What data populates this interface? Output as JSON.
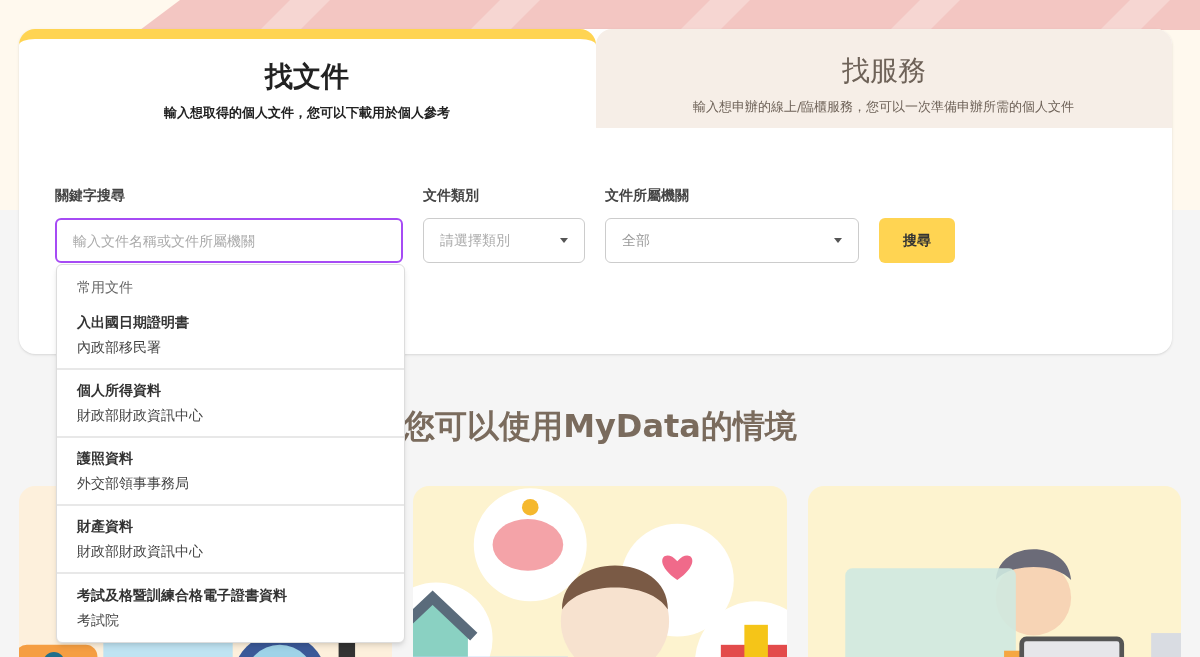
{
  "tabs": [
    {
      "title": "找文件",
      "subtitle": "輸入想取得的個人文件，您可以下載用於個人參考",
      "selected": true
    },
    {
      "title": "找服務",
      "subtitle": "輸入想申辦的線上/臨櫃服務，您可以一次準備申辦所需的個人文件",
      "selected": false
    }
  ],
  "search": {
    "keyword": {
      "label": "關鍵字搜尋",
      "placeholder": "輸入文件名稱或文件所屬機關",
      "focused": true
    },
    "category": {
      "label": "文件類別",
      "placeholder": "請選擇類別"
    },
    "agency": {
      "label": "文件所屬機關",
      "value": "全部"
    },
    "button": "搜尋"
  },
  "suggestions": {
    "heading": "常用文件",
    "items": [
      {
        "title": "入出國日期證明書",
        "agency": "內政部移民署"
      },
      {
        "title": "個人所得資料",
        "agency": "財政部財政資訊中心"
      },
      {
        "title": "護照資料",
        "agency": "外交部領事事務局"
      },
      {
        "title": "財產資料",
        "agency": "財政部財政資訊中心"
      },
      {
        "title": "考試及格暨訓練合格電子證書資料",
        "agency": "考試院"
      }
    ]
  },
  "scenarios": {
    "heading": "您可以使用MyData的情境"
  }
}
